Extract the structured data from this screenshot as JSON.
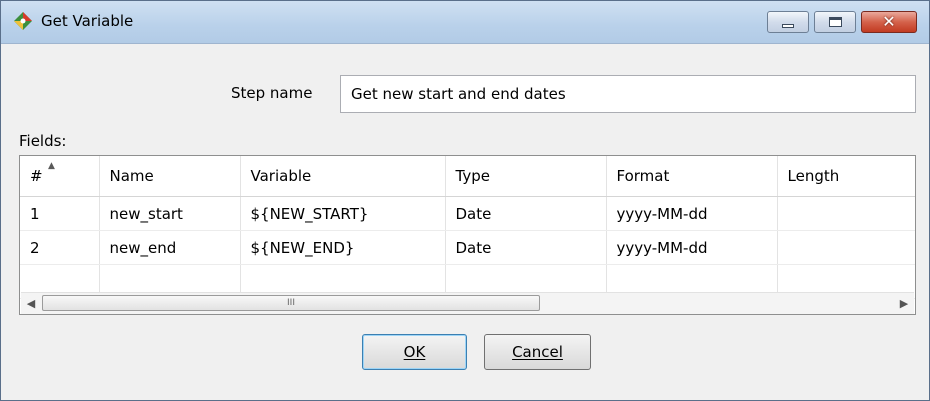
{
  "window": {
    "title": "Get Variable",
    "close_glyph": "✕"
  },
  "step": {
    "label": "Step name",
    "value": "Get new start and end dates"
  },
  "fields": {
    "label": "Fields:",
    "columns": [
      "#",
      "Name",
      "Variable",
      "Type",
      "Format",
      "Length"
    ],
    "rows": [
      {
        "num": "1",
        "name": "new_start",
        "variable": "${NEW_START}",
        "type": "Date",
        "format": "yyyy-MM-dd",
        "length": ""
      },
      {
        "num": "2",
        "name": "new_end",
        "variable": "${NEW_END}",
        "type": "Date",
        "format": "yyyy-MM-dd",
        "length": ""
      }
    ],
    "scroll_thumb_glyph": "III"
  },
  "buttons": {
    "ok": "OK",
    "cancel": "Cancel"
  },
  "icons": {
    "app": "kettle-step-icon",
    "minimize": "minimize-icon",
    "maximize": "maximize-icon",
    "close": "close-icon",
    "sort": "sort-ascending-icon"
  },
  "colors": {
    "title_bar": "#b9d1ea",
    "close_button": "#c23b22",
    "dialog_bg": "#f0f0f0"
  }
}
